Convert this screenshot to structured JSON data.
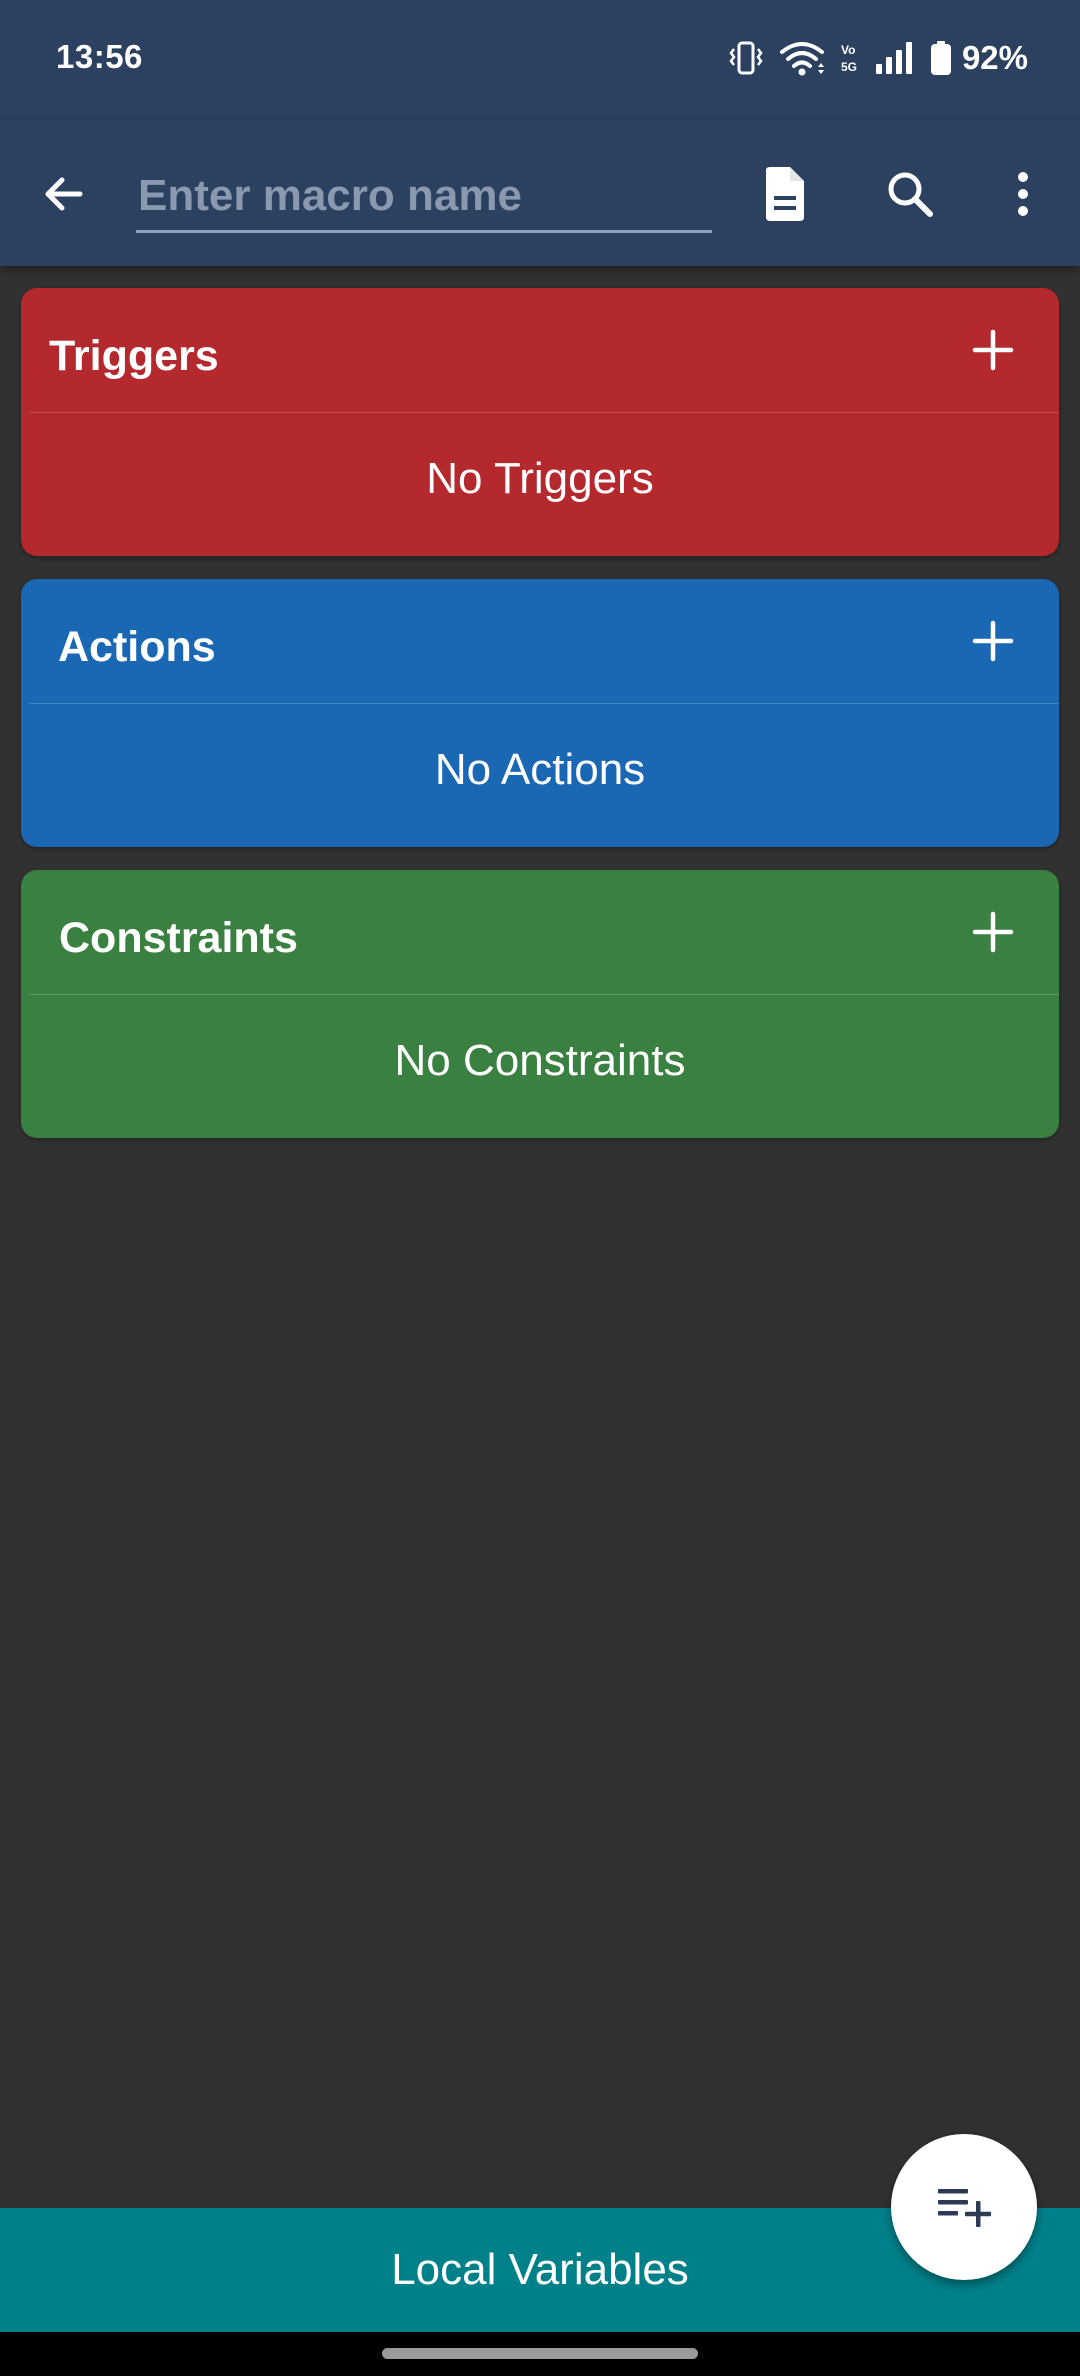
{
  "status_bar": {
    "time": "13:56",
    "battery_percent": "92%",
    "icons": [
      "vibrate-icon",
      "wifi-icon",
      "volte-icon",
      "signal-icon",
      "battery-icon"
    ]
  },
  "toolbar": {
    "name_input": {
      "value": "",
      "placeholder": "Enter macro name"
    },
    "icons": [
      "back-arrow-icon",
      "document-icon",
      "search-icon",
      "more-vert-icon"
    ]
  },
  "sections": {
    "triggers": {
      "title": "Triggers",
      "empty": "No Triggers",
      "color": "#b3292d"
    },
    "actions": {
      "title": "Actions",
      "empty": "No Actions",
      "color": "#1a67b3"
    },
    "constraints": {
      "title": "Constraints",
      "empty": "No Constraints",
      "color": "#3a8040"
    }
  },
  "bottom_bar": {
    "label": "Local Variables",
    "color": "#00818a"
  },
  "fab": {
    "icon": "playlist-add-icon"
  },
  "colors": {
    "header": "#2c4160",
    "background": "#313131"
  }
}
